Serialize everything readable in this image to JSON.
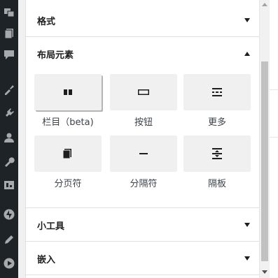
{
  "sidebar": {
    "items": [
      {
        "icon": "media-icon"
      },
      {
        "icon": "pages-icon"
      },
      {
        "icon": "comments-icon"
      },
      {
        "icon": "appearance-icon"
      },
      {
        "icon": "plugins-icon"
      },
      {
        "icon": "users-icon"
      },
      {
        "icon": "tools-icon"
      },
      {
        "icon": "settings-icon"
      },
      {
        "icon": "jetpack-icon"
      },
      {
        "icon": "edit-icon"
      },
      {
        "icon": "play-icon"
      }
    ]
  },
  "panel": {
    "formatting": {
      "title": "格式",
      "expanded": false
    },
    "layout": {
      "title": "布局元素",
      "expanded": true,
      "blocks": [
        {
          "label": "栏目（beta)",
          "icon": "columns-icon"
        },
        {
          "label": "按钮",
          "icon": "button-icon"
        },
        {
          "label": "更多",
          "icon": "more-icon"
        },
        {
          "label": "分页符",
          "icon": "page-break-icon"
        },
        {
          "label": "分隔符",
          "icon": "separator-icon"
        },
        {
          "label": "隔板",
          "icon": "spacer-icon"
        }
      ]
    },
    "widgets": {
      "title": "小工具",
      "expanded": false
    },
    "embeds": {
      "title": "嵌入",
      "expanded": false
    }
  }
}
